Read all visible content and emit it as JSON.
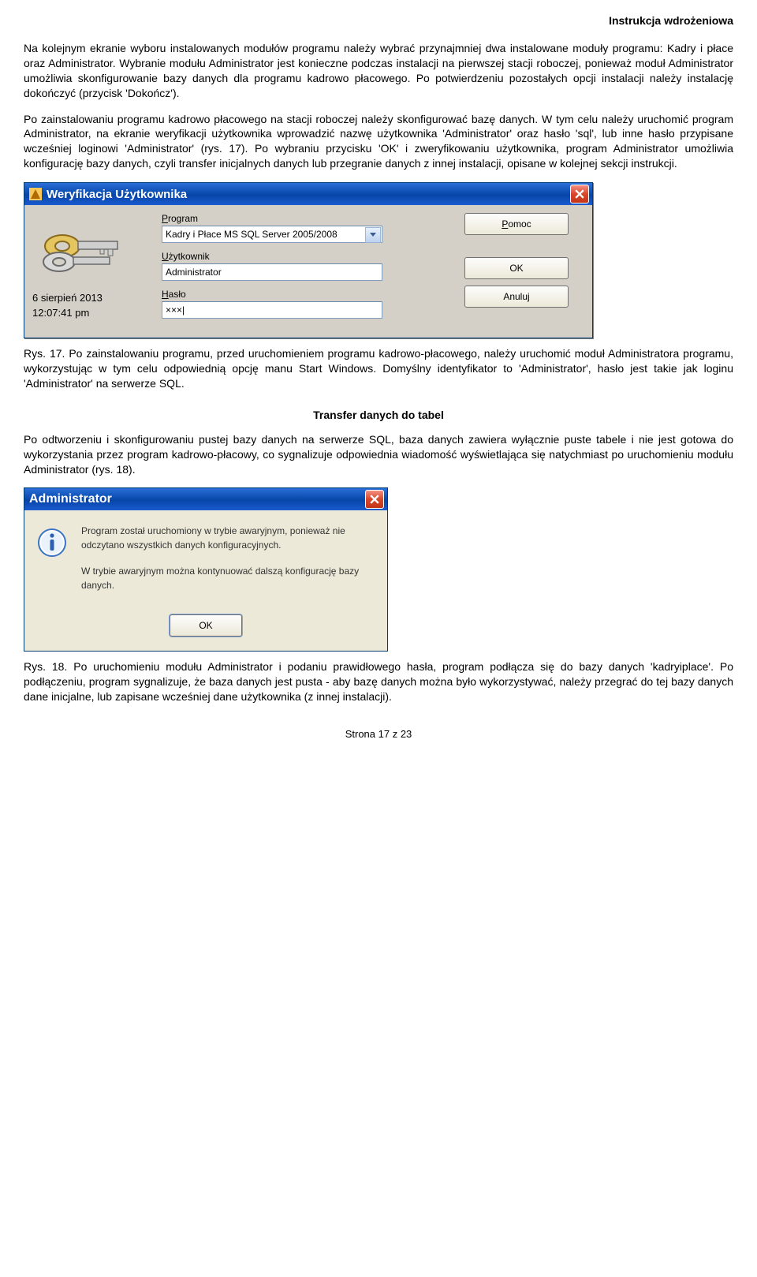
{
  "header_right": "Instrukcja wdrożeniowa",
  "p1": "Na kolejnym ekranie wyboru instalowanych modułów programu należy wybrać przynajmniej dwa instalowane moduły programu: Kadry i płace oraz Administrator. Wybranie modułu Administrator jest konieczne podczas instalacji na pierwszej stacji roboczej, ponieważ moduł Administrator umożliwia skonfigurowanie bazy danych dla programu kadrowo płacowego. Po potwierdzeniu pozostałych opcji instalacji należy instalację dokończyć (przycisk 'Dokończ').",
  "p2": "Po zainstalowaniu programu kadrowo płacowego na stacji roboczej należy skonfigurować bazę danych. W tym celu należy uruchomić program Administrator, na ekranie weryfikacji użytkownika wprowadzić nazwę użytkownika 'Administrator' oraz hasło 'sql', lub inne hasło przypisane wcześniej loginowi 'Administrator' (rys. 17). Po wybraniu przycisku 'OK' i zweryfikowaniu użytkownika, program Administrator umożliwia konfigurację bazy danych, czyli transfer inicjalnych danych lub przegranie danych z innej instalacji, opisane w kolejnej sekcji instrukcji.",
  "dialog1": {
    "title": "Weryfikacja Użytkownika",
    "program_label_pre": "P",
    "program_label_rest": "rogram",
    "program_value": "Kadry i Płace MS SQL Server 2005/2008",
    "user_label_pre": "U",
    "user_label_rest": "żytkownik",
    "user_value": "Administrator",
    "pass_label_pre": "H",
    "pass_label_rest": "asło",
    "pass_value": "×××|",
    "date": "6 sierpień 2013",
    "time": "12:07:41 pm",
    "btn_help_pre": "P",
    "btn_help_rest": "omoc",
    "btn_ok": "OK",
    "btn_cancel": "Anuluj"
  },
  "caption1": "Rys. 17. Po zainstalowaniu programu, przed uruchomieniem programu kadrowo-płacowego, należy uruchomić moduł Administratora programu, wykorzystując w tym celu odpowiednią opcję manu Start Windows. Domyślny identyfikator to 'Administrator', hasło jest takie jak loginu 'Administrator' na serwerze SQL.",
  "section_title": "Transfer danych do tabel",
  "p3": "Po odtworzeniu i skonfigurowaniu pustej bazy danych na serwerze SQL, baza danych zawiera wyłącznie puste tabele i nie jest gotowa do wykorzystania przez program kadrowo-płacowy, co sygnalizuje odpowiednia wiadomość wyświetlająca się natychmiast po uruchomieniu modułu Administrator (rys. 18).",
  "dialog2": {
    "title": "Administrator",
    "msg1": "Program został uruchomiony w trybie awaryjnym, ponieważ nie odczytano wszystkich danych konfiguracyjnych.",
    "msg2": "W trybie awaryjnym można kontynuować dalszą konfigurację bazy danych.",
    "btn_ok": "OK"
  },
  "caption2": "Rys. 18. Po uruchomieniu modułu Administrator i podaniu prawidłowego hasła, program podłącza się do bazy danych 'kadryiplace'. Po podłączeniu, program sygnalizuje, że baza danych jest pusta - aby bazę danych można było wykorzystywać, należy przegrać do tej bazy danych dane inicjalne, lub zapisane wcześniej dane użytkownika (z innej instalacji).",
  "footer": "Strona 17 z 23"
}
